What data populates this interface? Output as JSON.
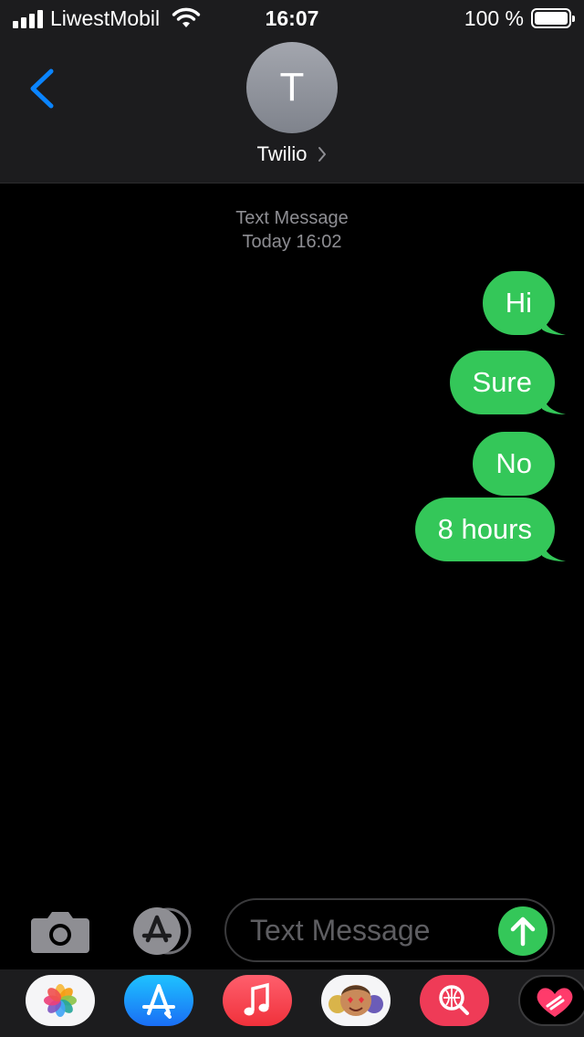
{
  "status_bar": {
    "carrier": "LiwestMobil",
    "time": "16:07",
    "battery": "100 %",
    "battery_level": 1.0
  },
  "header": {
    "back_icon": "chevron-left-icon",
    "avatar_initial": "T",
    "contact_name": "Twilio"
  },
  "thread": {
    "service": "Text Message",
    "timestamp": "Today 16:02",
    "messages": [
      {
        "text": "Hi",
        "direction": "sent"
      },
      {
        "text": "Sure",
        "direction": "sent"
      },
      {
        "text": "No",
        "direction": "sent"
      },
      {
        "text": "8 hours",
        "direction": "sent"
      }
    ]
  },
  "composer": {
    "camera_icon": "camera-icon",
    "apps_icon": "app-store-icon",
    "placeholder": "Text Message",
    "send_icon": "arrow-up-icon"
  },
  "app_drawer": {
    "apps": [
      "Photos",
      "App Store",
      "Music",
      "Memoji",
      "Search Images",
      "Digital Touch"
    ]
  },
  "colors": {
    "bubble_green": "#34c759",
    "accent_blue": "#0a84ff",
    "bar_background": "#1c1c1e"
  }
}
